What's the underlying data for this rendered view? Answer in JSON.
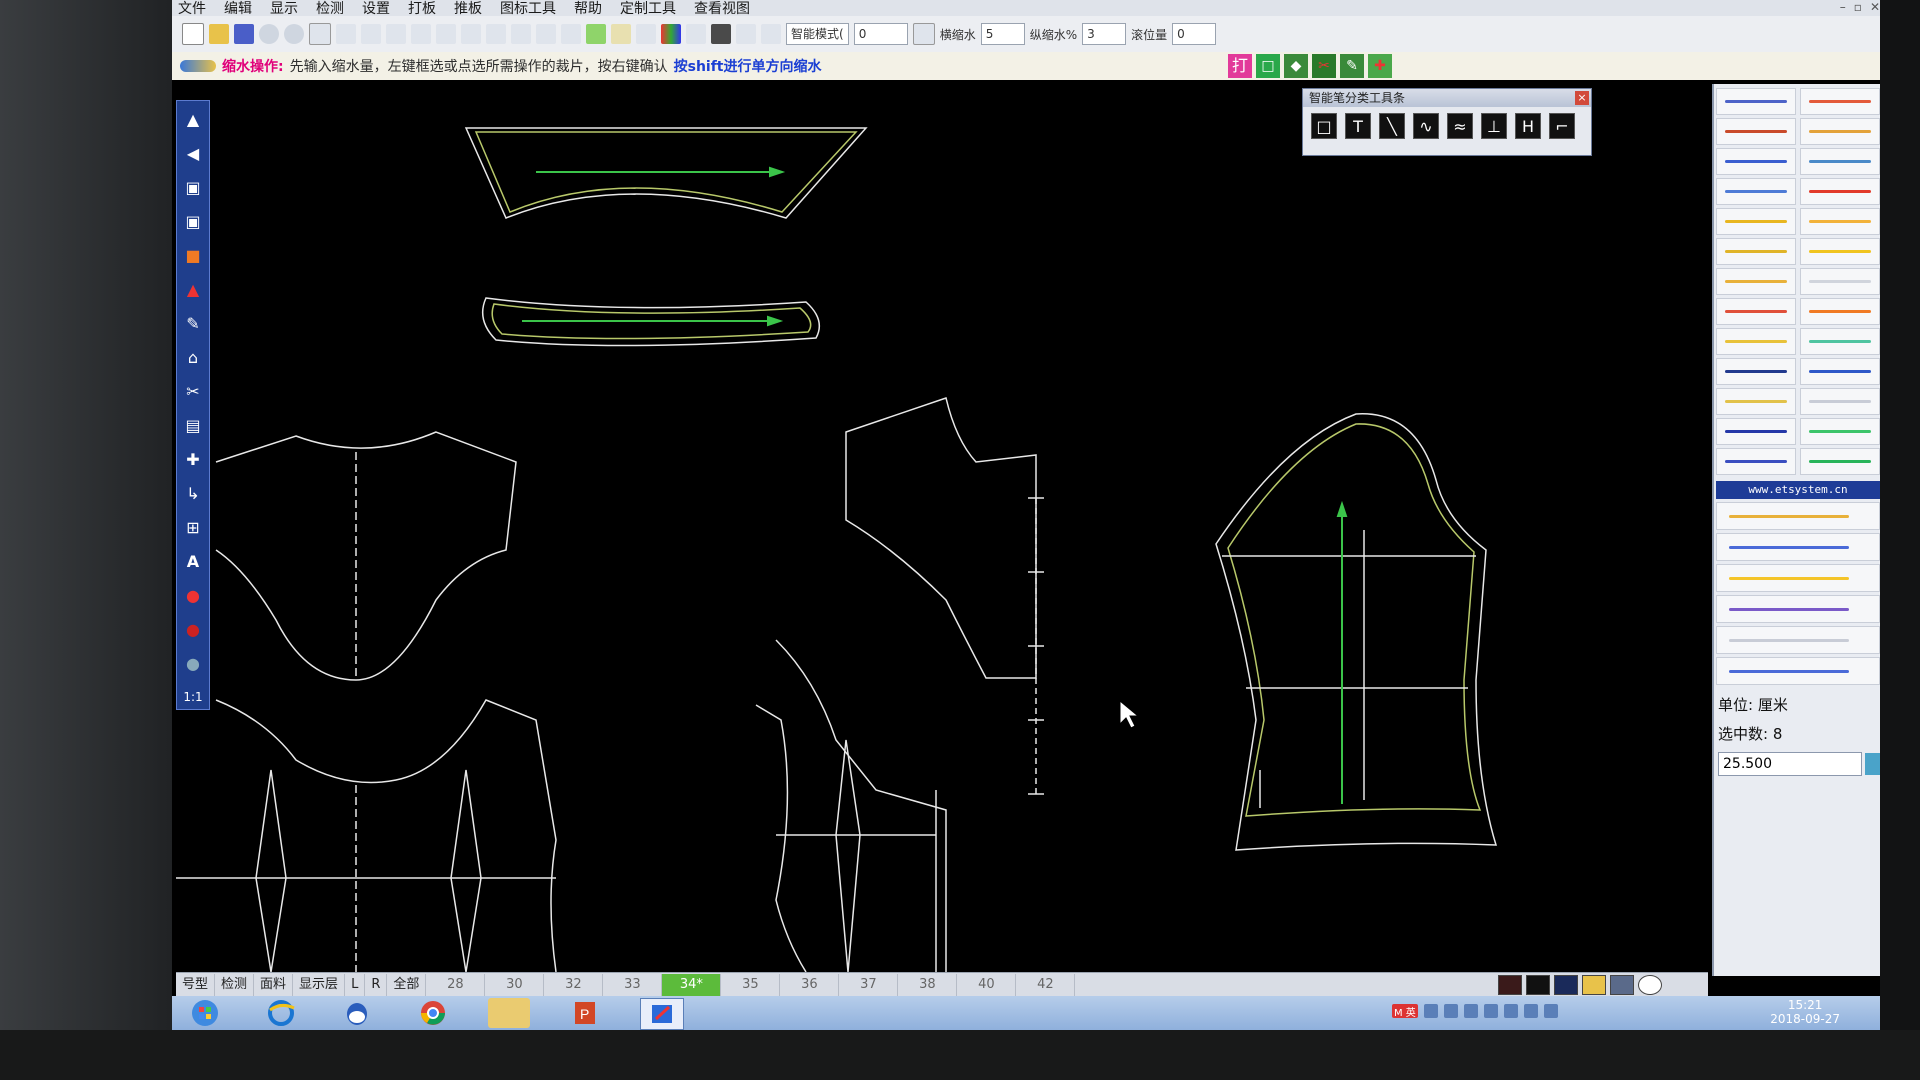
{
  "menu": {
    "items": [
      "文件",
      "编辑",
      "显示",
      "检测",
      "设置",
      "打板",
      "推板",
      "图标工具",
      "帮助",
      "定制工具",
      "查看视图"
    ],
    "window_controls": [
      "–",
      "▫",
      "✕"
    ]
  },
  "toolbar": {
    "mode_select": "智能模式(",
    "mode_value": "0",
    "horizontal_shrink_label": "横缩水",
    "horizontal_shrink_value": "5",
    "vertical_shrink_label": "纵缩水%",
    "vertical_shrink_value": "3",
    "roll_label": "滚位量",
    "roll_value": "0",
    "icons": [
      "new-file",
      "open-folder",
      "save",
      "zoom-out",
      "zoom-in",
      "zoom-fit",
      "pan",
      "zoom-window",
      "undo",
      "redo",
      "select",
      "move",
      "align",
      "rotate",
      "mirror",
      "measure",
      "ruler",
      "curve",
      "pen",
      "color-palette",
      "grid",
      "sample",
      "calc",
      "settings-设"
    ]
  },
  "hint": {
    "operation": "缩水操作:",
    "text": "先输入缩水量，左键框选或点选所需操作的裁片，按右键确认",
    "shift_text": "按shift进行单方向缩水",
    "buttons": [
      "打",
      "□",
      "◆",
      "✂",
      "✎",
      "✚"
    ]
  },
  "left_tools": [
    "▲",
    "◀",
    "▣",
    "▣",
    "■",
    "▲",
    "✎",
    "⌂",
    "✂",
    "▤",
    "✚",
    "↳",
    "⊞",
    "A",
    "●",
    "●",
    "●",
    "1:1"
  ],
  "smart_pen_panel": {
    "title": "智能笔分类工具条",
    "tools": [
      "□",
      "T",
      "╲",
      "∿",
      "≈",
      "⊥",
      "H",
      "⌐"
    ]
  },
  "right_panel": {
    "url": "www.etsystem.cn",
    "unit_label": "单位: 厘米",
    "selected_label": "选中数: 8",
    "value": "25.500",
    "button_colors": [
      "#4d63c8",
      "#e35a3a",
      "#c94a2a",
      "#e3a23a",
      "#3a5ed0",
      "#4a8ac8",
      "#4e7bd6",
      "#e23a2a",
      "#e8b620",
      "#f2b23a",
      "#e0b428",
      "#f0c420",
      "#e8b13a",
      "#d0d4dc",
      "#e0503a",
      "#f07a24",
      "#e8c23a",
      "#4fc4a0",
      "#223a8e",
      "#2e58c8",
      "#e2c24a",
      "#c8ccd6",
      "#2538a8",
      "#3cc46a",
      "#3a4ec0",
      "#28b45a"
    ],
    "wide_colors": [
      "#e8b13a",
      "#4a6ad8",
      "#f4c428",
      "#7a5ac8",
      "#c8ccd6",
      "#4a6ad8"
    ]
  },
  "sizes": {
    "tabs": [
      "号型",
      "检测",
      "面料",
      "显示层",
      "L",
      "R",
      "全部"
    ],
    "values": [
      "28",
      "30",
      "32",
      "33",
      "34*",
      "35",
      "36",
      "37",
      "38",
      "40",
      "42"
    ],
    "active": "34*"
  },
  "taskbar": {
    "time": "15:21",
    "date": "2018-09-27",
    "ime": "M 英"
  }
}
